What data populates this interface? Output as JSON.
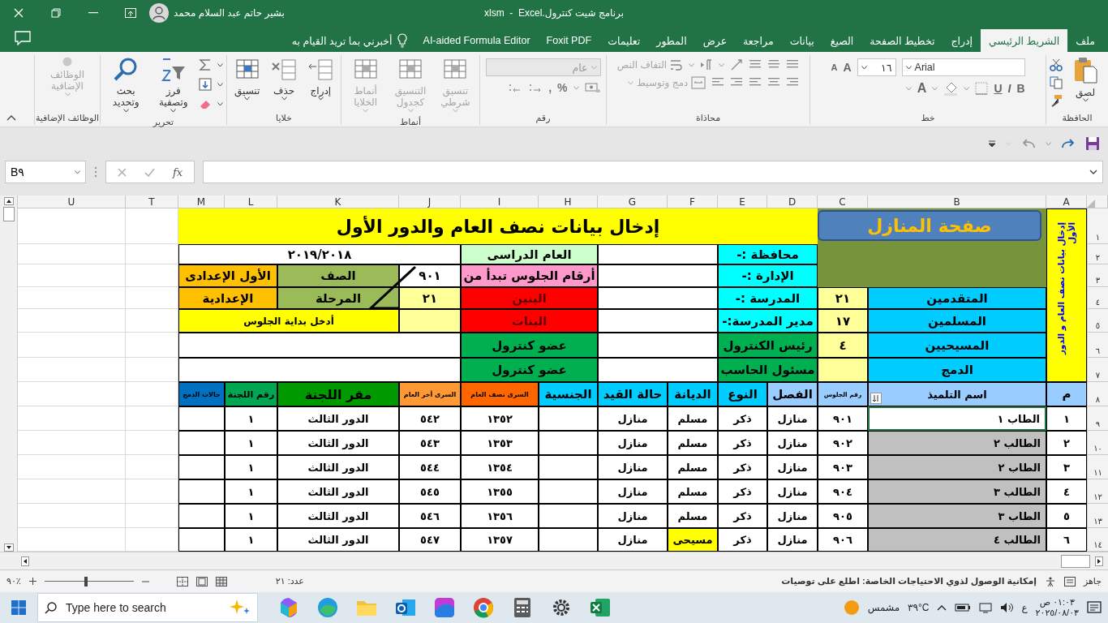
{
  "window": {
    "title": "برنامج شيت كنترول.xlsm  -  Excel",
    "user": "بشير حاتم  عبد السلام محمد"
  },
  "tabs": [
    {
      "label": "ملف",
      "selected": false
    },
    {
      "label": "الشريط الرئيسي",
      "selected": true
    },
    {
      "label": "إدراج",
      "selected": false
    },
    {
      "label": "تخطيط الصفحة",
      "selected": false
    },
    {
      "label": "الصيغ",
      "selected": false
    },
    {
      "label": "بيانات",
      "selected": false
    },
    {
      "label": "مراجعة",
      "selected": false
    },
    {
      "label": "عرض",
      "selected": false
    },
    {
      "label": "المطور",
      "selected": false
    },
    {
      "label": "تعليمات",
      "selected": false
    },
    {
      "label": "Foxit PDF",
      "selected": false
    },
    {
      "label": "AI-aided Formula Editor",
      "selected": false
    }
  ],
  "tell_me": "أخبرني بما تريد القيام به",
  "ribbon": {
    "groups": [
      {
        "kind": "clipboard",
        "label": "الحافظة",
        "buttons": [
          {
            "label": "لصق",
            "disabled": false
          }
        ]
      },
      {
        "kind": "font",
        "label": "خط",
        "font": "Arial",
        "size": "١٦",
        "grow": "A",
        "shrink": "A",
        "bold": "B",
        "italic": "I",
        "underline": "U",
        "font_color": "A"
      },
      {
        "kind": "alignment",
        "label": "محاذاة",
        "buttons": [
          {
            "label": "التفاف النص",
            "disabled": true
          },
          {
            "label": "دمج وتوسيط",
            "disabled": true
          }
        ]
      },
      {
        "kind": "number",
        "label": "رقم",
        "format": "عام",
        "percent": "%",
        "comma": ","
      },
      {
        "kind": "large",
        "label": "أنماط",
        "buttons": [
          {
            "label": "تنسيق شرطي",
            "disabled": true
          },
          {
            "label": "التنسيق كجدول",
            "disabled": true
          },
          {
            "label": "أنماط الخلايا",
            "disabled": true
          }
        ]
      },
      {
        "kind": "large",
        "label": "خلايا",
        "buttons": [
          {
            "label": "إدراج",
            "disabled": false
          },
          {
            "label": "حذف",
            "disabled": false
          },
          {
            "label": "تنسيق",
            "disabled": false
          }
        ]
      },
      {
        "kind": "editing",
        "label": "تحرير",
        "buttons": [
          {
            "label": "فرز وتصفية",
            "disabled": false
          },
          {
            "label": "بحث وتحديد",
            "disabled": false
          }
        ]
      },
      {
        "kind": "large",
        "label": "الوظائف الإضافية",
        "buttons": [
          {
            "label": "الوظائف الإضافية",
            "disabled": true
          }
        ]
      }
    ]
  },
  "formula_bar": {
    "name_box": "B٩",
    "fx": "fx"
  },
  "sheet": {
    "columns": [
      "A",
      "B",
      "C",
      "D",
      "E",
      "F",
      "G",
      "H",
      "I",
      "J",
      "K",
      "L",
      "M",
      "T",
      "U"
    ],
    "row_numbers": [
      "١",
      "٢",
      "٣",
      "٤",
      "٥",
      "٦",
      "٧",
      "٨",
      "٩",
      "١٠",
      "١١",
      "١٢",
      "١٣",
      "١٤"
    ],
    "title": "إدخال بيانات نصف العام والدور الأول",
    "home_button": "صفحة المنازل",
    "side_note": "إدخال بيانات نصف العام و الدور الأول",
    "form_cells": [
      {
        "text": "محافظة :-",
        "color": "#00ffff"
      },
      {
        "color": "#ffffff"
      },
      {
        "text": "العام الدراسى",
        "color": "#ccffcc"
      },
      {
        "text": "٢٠١٩/٢٠١٨",
        "color": "#ffffff"
      },
      {
        "text": "الإدارة :-",
        "color": "#00ffff"
      },
      {
        "color": "#ffffff"
      },
      {
        "text": "أرقام الجلوس تبدأ من",
        "color": "#ff99cc"
      },
      {
        "text": "٩٠١",
        "color": "#ffffff"
      },
      {
        "text": "الصف",
        "color": "#9bbb59"
      },
      {
        "text": "الأول الإعدادى",
        "color": "#ffc000"
      },
      {
        "text": "المتقدمين",
        "color": "#00ccff"
      },
      {
        "text": "٢١",
        "color": "#ffff99"
      },
      {
        "text": "المدرسة :-",
        "color": "#00ffff"
      },
      {
        "color": "#ffffff"
      },
      {
        "text": "البنين",
        "color": "#ff0000"
      },
      {
        "text": "٢١",
        "color": "#ffff99"
      },
      {
        "text": "المرحلة",
        "color": "#9bbb59"
      },
      {
        "text": "الإعدادية",
        "color": "#ffc000"
      },
      {
        "text": "المسلمين",
        "color": "#00ccff"
      },
      {
        "text": "١٧",
        "color": "#ffff99"
      },
      {
        "text": "مدير المدرسة:-",
        "color": "#00ffff"
      },
      {
        "color": "#ffffff"
      },
      {
        "text": "البنات",
        "color": "#ff0000"
      },
      {
        "color": "#ffff99"
      },
      {
        "text": "أدخل بداية الجلوس",
        "color": "#ffff00"
      },
      {
        "text": "المسيحيين",
        "color": "#00ccff"
      },
      {
        "text": "٤",
        "color": "#ffff99"
      },
      {
        "text": "رئيس الكنترول",
        "color": "#00b050"
      },
      {
        "color": "#ffffff"
      },
      {
        "text": "عضو كنترول",
        "color": "#00b050"
      },
      {
        "color": "#ffffff"
      },
      {
        "text": "الدمج",
        "color": "#00ccff"
      },
      {
        "color": "#ffff99"
      },
      {
        "text": "مسئول الحاسب",
        "color": "#00b050"
      },
      {
        "color": "#ffffff"
      },
      {
        "text": "عضو كنترول",
        "color": "#00b050"
      },
      {
        "color": "#ffffff"
      }
    ],
    "headers": [
      {
        "text": "م",
        "color": "#99ccff"
      },
      {
        "text": "اسم التلميذ",
        "color": "#99ccff"
      },
      {
        "text": "رقم الجلوس",
        "color": "#99ccff"
      },
      {
        "text": "الفصل",
        "color": "#99ccff"
      },
      {
        "text": "النوع",
        "color": "#00ccff"
      },
      {
        "text": "الديانة",
        "color": "#00ccff"
      },
      {
        "text": "حالة القيد",
        "color": "#00ccff"
      },
      {
        "text": "الجنسية",
        "color": "#00ccff"
      },
      {
        "text": "السرى نصف العام",
        "color": "#ff6600"
      },
      {
        "text": "السرى أخر العام",
        "color": "#ff9933"
      },
      {
        "text": "مقر اللجنة",
        "color": "#009900"
      },
      {
        "text": "رقم اللجنة",
        "color": "#00a651"
      },
      {
        "text": "حالات الدمج",
        "color": "#0070c0"
      }
    ],
    "rows": [
      {
        "number": "١",
        "name": "الطاب ١",
        "name_selected": true,
        "seat": "٩٠١",
        "class": "منازل",
        "gender": "ذكر",
        "religion": "مسلم",
        "religion_highlighted": false,
        "status": "منازل",
        "serial_mid": "١٣٥٢",
        "serial_end": "٥٤٢",
        "venue": "الدور الثالث",
        "committee": "١"
      },
      {
        "number": "٢",
        "name": "الطالب ٢",
        "name_selected": false,
        "seat": "٩٠٢",
        "class": "منازل",
        "gender": "ذكر",
        "religion": "مسلم",
        "religion_highlighted": false,
        "status": "منازل",
        "serial_mid": "١٣٥٣",
        "serial_end": "٥٤٣",
        "venue": "الدور الثالث",
        "committee": "١"
      },
      {
        "number": "٣",
        "name": "الطاب ٢",
        "name_selected": false,
        "seat": "٩٠٣",
        "class": "منازل",
        "gender": "ذكر",
        "religion": "مسلم",
        "religion_highlighted": false,
        "status": "منازل",
        "serial_mid": "١٣٥٤",
        "serial_end": "٥٤٤",
        "venue": "الدور الثالث",
        "committee": "١"
      },
      {
        "number": "٤",
        "name": "الطالب ٣",
        "name_selected": false,
        "seat": "٩٠٤",
        "class": "منازل",
        "gender": "ذكر",
        "religion": "مسلم",
        "religion_highlighted": false,
        "status": "منازل",
        "serial_mid": "١٣٥٥",
        "serial_end": "٥٤٥",
        "venue": "الدور الثالث",
        "committee": "١"
      },
      {
        "number": "٥",
        "name": "الطاب ٣",
        "name_selected": false,
        "seat": "٩٠٥",
        "class": "منازل",
        "gender": "ذكر",
        "religion": "مسلم",
        "religion_highlighted": false,
        "status": "منازل",
        "serial_mid": "١٣٥٦",
        "serial_end": "٥٤٦",
        "venue": "الدور الثالث",
        "committee": "١"
      },
      {
        "number": "٦",
        "name": "الطالب ٤",
        "name_selected": false,
        "seat": "٩٠٦",
        "class": "منازل",
        "gender": "ذكر",
        "religion": "مسيحى",
        "religion_highlighted": true,
        "status": "منازل",
        "serial_mid": "١٣٥٧",
        "serial_end": "٥٤٧",
        "venue": "الدور الثالث",
        "committee": "١"
      }
    ]
  },
  "status_bar": {
    "ready": "جاهز",
    "accessibility": "إمكانية الوصول لذوي الاحتياجات الخاصة: اطلع على توصيات",
    "count": "عدد: ٢١",
    "zoom": "٩٠٪",
    "level": 0.47
  },
  "taskbar": {
    "search_placeholder": "Type here to search",
    "weather": "مشمس",
    "temperature": "٣٩°C",
    "language": "ع",
    "time": "٠١:٠٣ ص",
    "date": "٢٠٢٥/٠٨/٠٣"
  }
}
